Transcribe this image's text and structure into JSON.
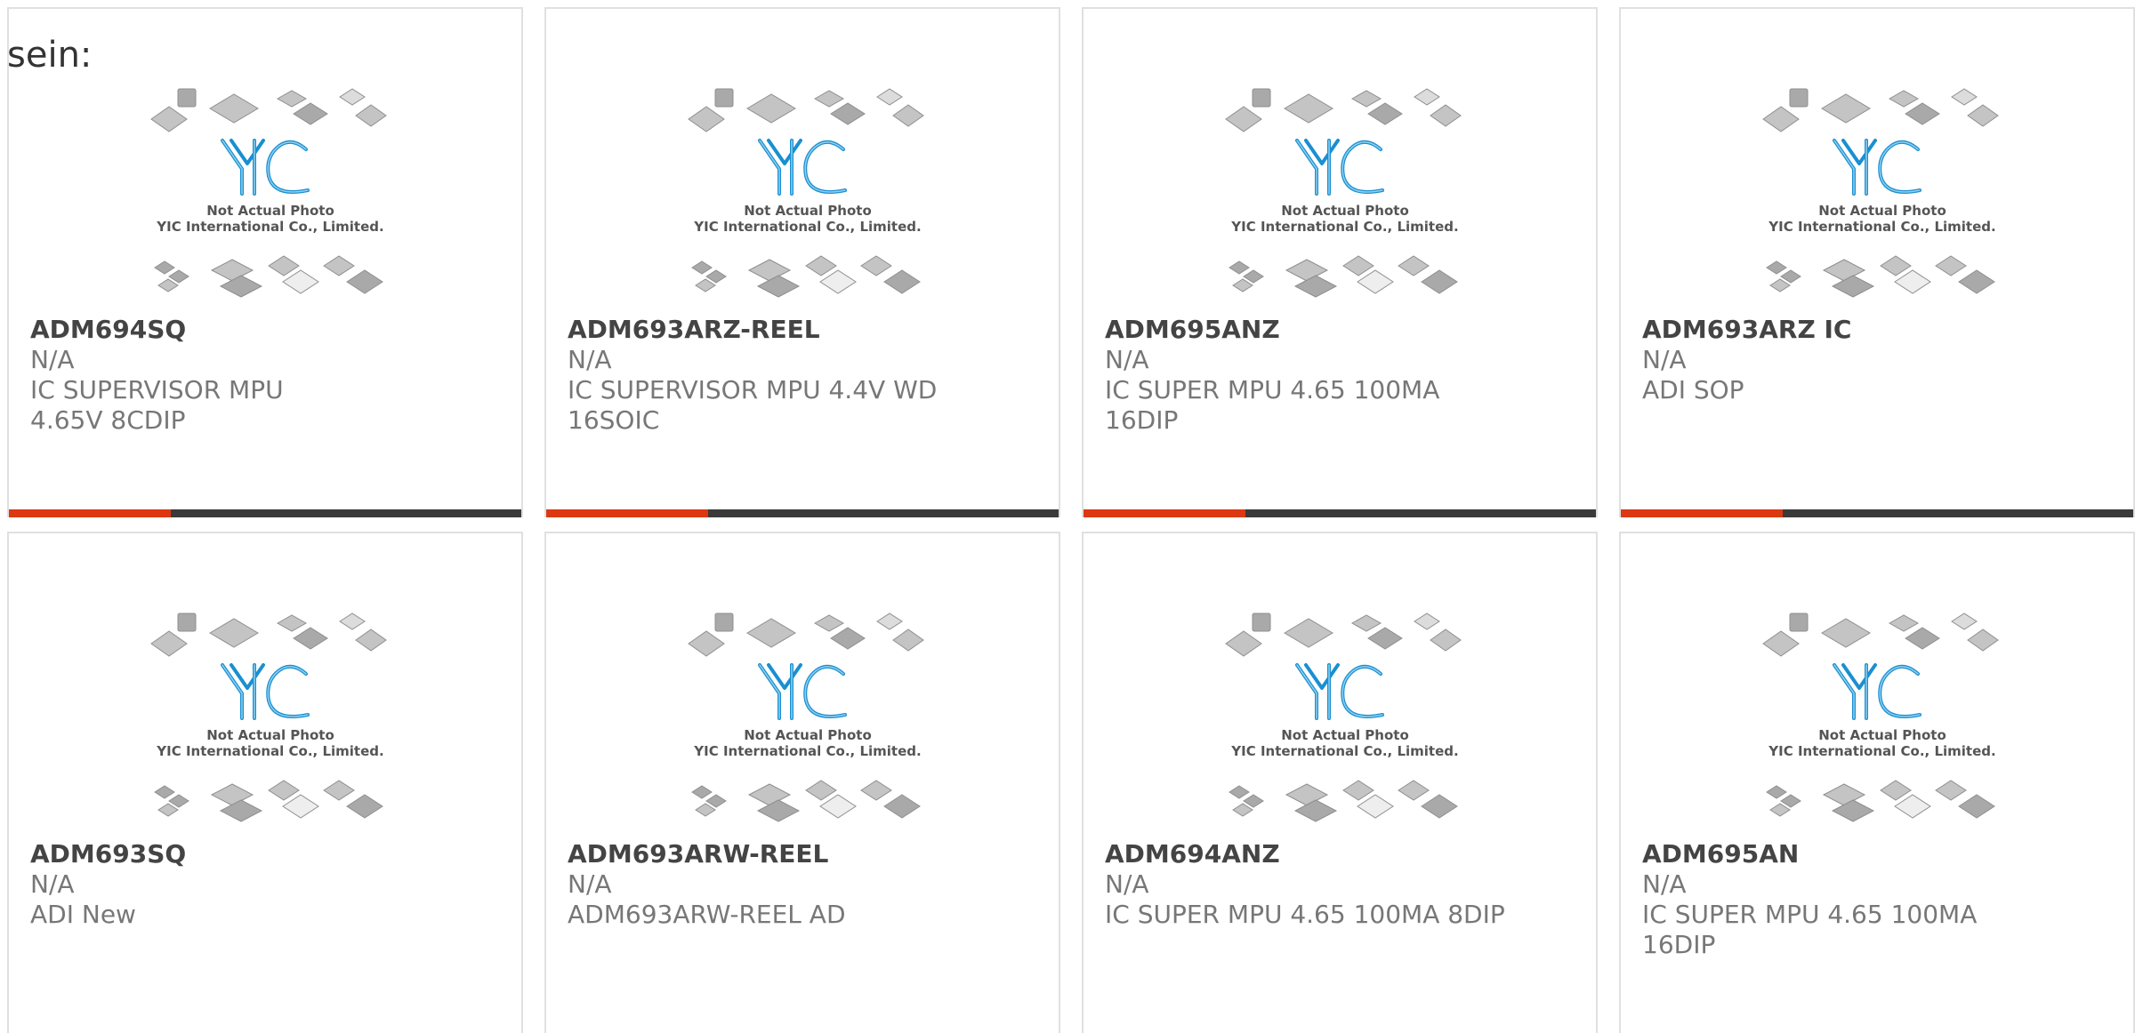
{
  "intro_text": "sein:",
  "photo": {
    "logo_text": "YIC",
    "caption_line1": "Not Actual Photo",
    "caption_line2": "YIC International Co., Limited."
  },
  "colors": {
    "accent": "#dc3912",
    "bar": "#3a3a3a",
    "logo_blue": "#1a8fd1",
    "chip_gray": "#b0b0b0"
  },
  "products": [
    {
      "part_number": "ADM694SQ",
      "availability": "N/A",
      "description": "IC SUPERVISOR MPU 4.65V 8CDIP"
    },
    {
      "part_number": "ADM693ARZ-REEL",
      "availability": "N/A",
      "description": "IC SUPERVISOR MPU 4.4V WD 16SOIC"
    },
    {
      "part_number": "ADM695ANZ",
      "availability": "N/A",
      "description": "IC SUPER MPU 4.65 100MA 16DIP"
    },
    {
      "part_number": "ADM693ARZ IC",
      "availability": "N/A",
      "description": "ADI SOP"
    },
    {
      "part_number": "ADM693SQ",
      "availability": "N/A",
      "description": "ADI New"
    },
    {
      "part_number": "ADM693ARW-REEL",
      "availability": "N/A",
      "description": "ADM693ARW-REEL AD"
    },
    {
      "part_number": "ADM694ANZ",
      "availability": "N/A",
      "description": "IC SUPER MPU 4.65 100MA 8DIP"
    },
    {
      "part_number": "ADM695AN",
      "availability": "N/A",
      "description": "IC SUPER MPU 4.65 100MA 16DIP"
    }
  ]
}
